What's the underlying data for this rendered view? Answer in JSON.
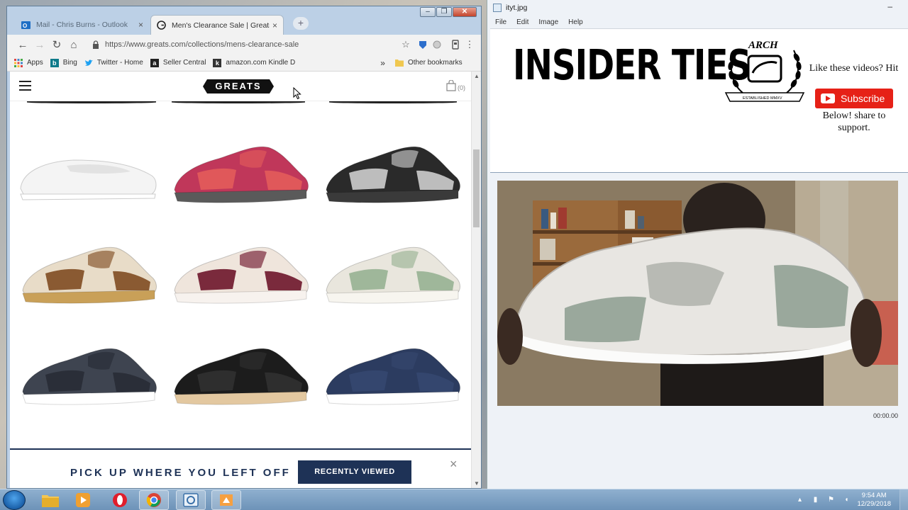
{
  "browser": {
    "tabs": [
      {
        "title": "Mail - Chris Burns - Outlook",
        "active": false
      },
      {
        "title": "Men's Clearance Sale | Greats",
        "active": true
      }
    ],
    "url": "https://www.greats.com/collections/mens-clearance-sale",
    "bookmarks": [
      {
        "label": "Apps",
        "icon": "apps-grid-icon"
      },
      {
        "label": "Bing",
        "icon": "bing-icon"
      },
      {
        "label": "Twitter - Home",
        "icon": "twitter-icon"
      },
      {
        "label": "Seller Central",
        "icon": "amazon-icon"
      },
      {
        "label": "amazon.com Kindle D",
        "icon": "kindle-icon"
      }
    ],
    "overflow_label": "»",
    "other_bookmarks": "Other bookmarks"
  },
  "site": {
    "logo": "GREATS",
    "cart_count": "(0)",
    "products": [
      {
        "name": "white-slip-on",
        "colors": [
          "#f4f4f4",
          "#e2e2e2",
          "#ffffff"
        ]
      },
      {
        "name": "pink-red-runner",
        "colors": [
          "#c0375a",
          "#e0585a",
          "#5a5a5a"
        ]
      },
      {
        "name": "black-grey-runner",
        "colors": [
          "#2a2a2a",
          "#bdbdbd",
          "#3a3a3a"
        ]
      },
      {
        "name": "tan-brown-runner",
        "colors": [
          "#e8dcc8",
          "#8a5a32",
          "#c9a058"
        ]
      },
      {
        "name": "burgundy-cream-runner",
        "colors": [
          "#efe5dc",
          "#7a2a3c",
          "#f7f2ee"
        ]
      },
      {
        "name": "sage-cream-runner",
        "colors": [
          "#e9e6dd",
          "#9fb79a",
          "#f7f5ef"
        ]
      },
      {
        "name": "charcoal-runner",
        "colors": [
          "#3e4450",
          "#2a2e38",
          "#ffffff"
        ]
      },
      {
        "name": "black-gum-runner",
        "colors": [
          "#1c1c1c",
          "#2e2e2e",
          "#e3c8a0"
        ]
      },
      {
        "name": "navy-runner",
        "colors": [
          "#2c3c60",
          "#34466e",
          "#ffffff"
        ]
      }
    ],
    "recent": {
      "text": "PICK UP WHERE YOU LEFT OFF",
      "button": "RECENTLY VIEWED",
      "close": "×"
    }
  },
  "viewer": {
    "title": "ityt.jpg",
    "menu": [
      "File",
      "Edit",
      "Image",
      "Help"
    ],
    "thumbnail": {
      "headline": "INSIDER TIES",
      "logo_top": "ARCH",
      "logo_bottom": "ESTABLISHED MMXV",
      "like_text": "Like these videos? Hit",
      "subscribe": "Subscribe",
      "below_text": "Below! share to support."
    },
    "timecode": "00:00.00"
  },
  "taskbar": {
    "time": "9:54 AM",
    "date": "12/29/2018"
  },
  "colors": {
    "greats_navy": "#1e3256",
    "youtube_red": "#e62117"
  }
}
